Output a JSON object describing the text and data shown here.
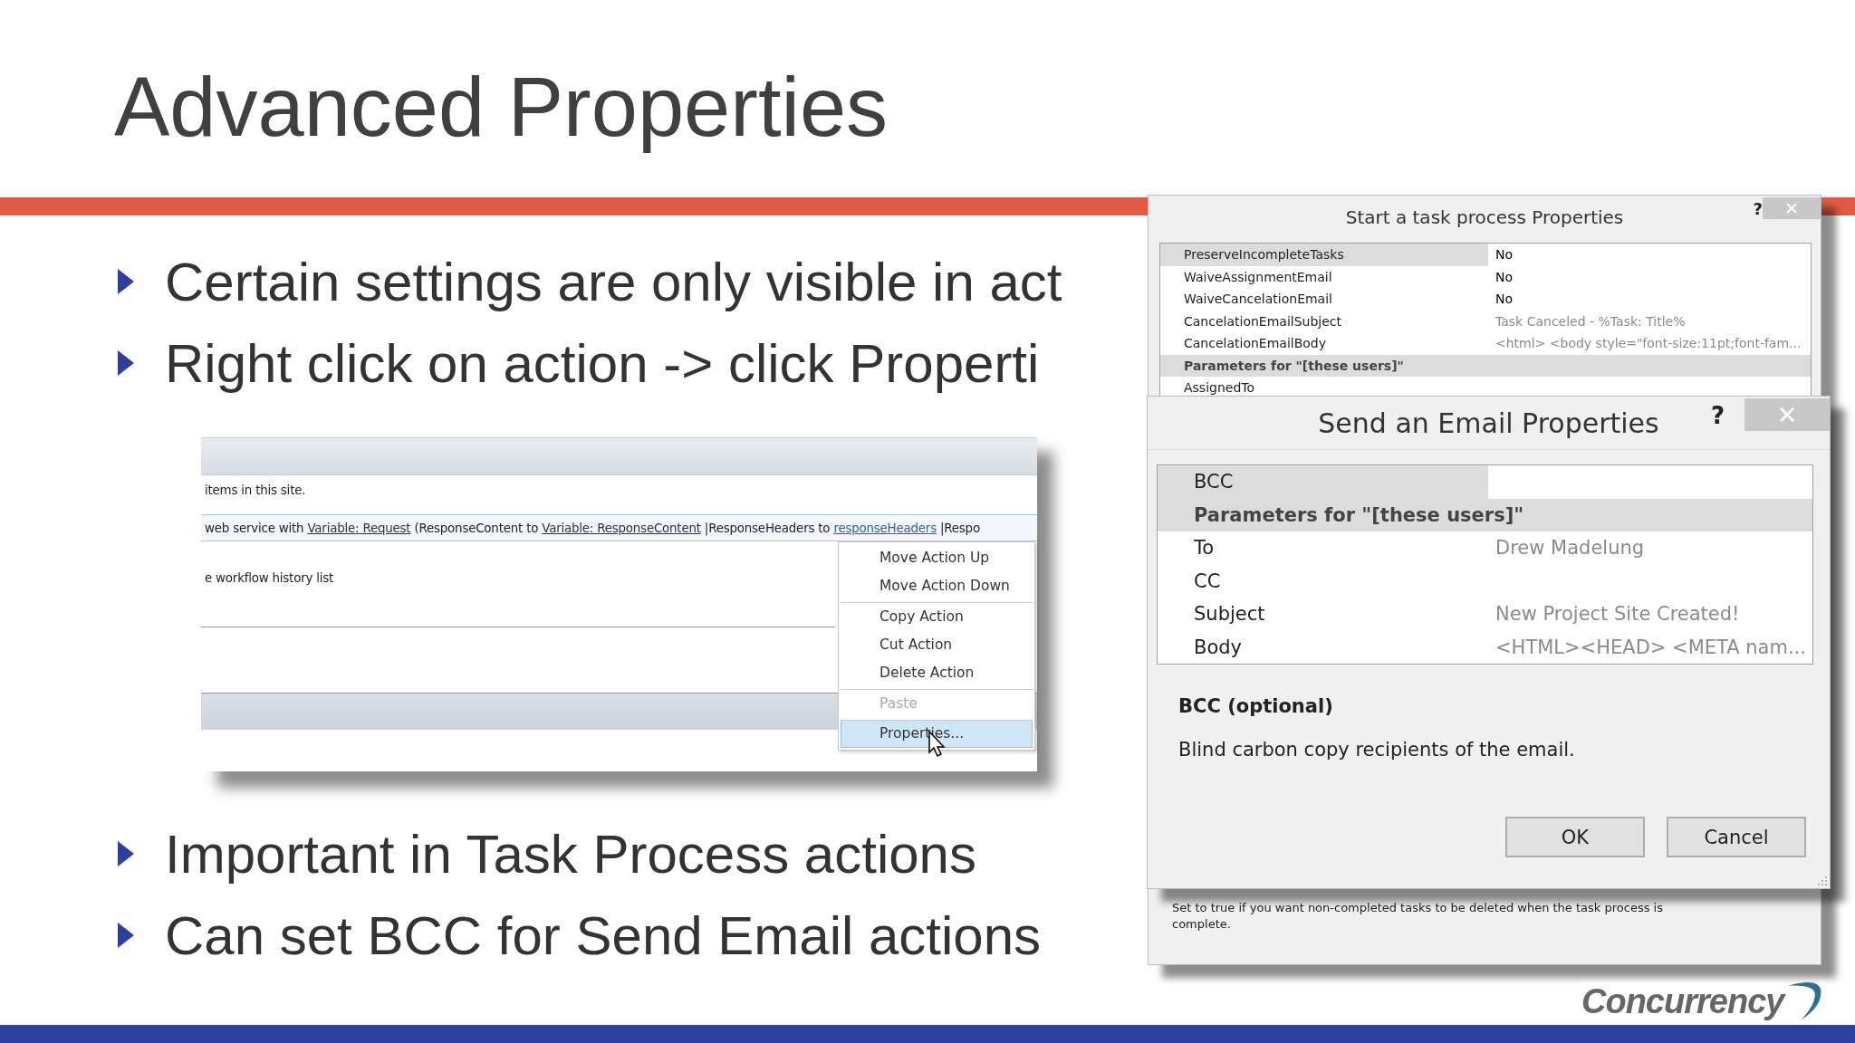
{
  "slide": {
    "title": "Advanced Properties",
    "bullets_top": [
      "Certain settings are only visible in act",
      "Right click on action -> click Properti"
    ],
    "bullets_bottom": [
      "Important in Task Process actions",
      "Can set BCC for Send Email actions"
    ]
  },
  "designer_screenshot": {
    "rows": [
      {
        "selected": false,
        "segments": [
          {
            "kind": "text",
            "text": "items in this site."
          }
        ]
      },
      {
        "selected": true,
        "segments": [
          {
            "kind": "text",
            "text": "web service with "
          },
          {
            "kind": "link",
            "text": "Variable: Request"
          },
          {
            "kind": "text",
            "text": " (ResponseContent to "
          },
          {
            "kind": "link",
            "text": "Variable: ResponseContent"
          },
          {
            "kind": "text",
            "text": " |ResponseHeaders to "
          },
          {
            "kind": "link_blue",
            "text": "responseHeaders"
          },
          {
            "kind": "text",
            "text": " |Respo"
          }
        ]
      },
      {
        "selected": false,
        "segments": [
          {
            "kind": "text",
            "text": "e workflow history list"
          }
        ]
      }
    ],
    "context_menu": [
      {
        "label": "Move Action Up",
        "disabled": false,
        "selected": false,
        "separator_before": false
      },
      {
        "label": "Move Action Down",
        "disabled": false,
        "selected": false,
        "separator_before": false
      },
      {
        "label": "Copy Action",
        "disabled": false,
        "selected": false,
        "separator_before": true
      },
      {
        "label": "Cut Action",
        "disabled": false,
        "selected": false,
        "separator_before": false
      },
      {
        "label": "Delete Action",
        "disabled": false,
        "selected": false,
        "separator_before": false
      },
      {
        "label": "Paste",
        "disabled": true,
        "selected": false,
        "separator_before": true
      },
      {
        "label": "Properties...",
        "disabled": false,
        "selected": true,
        "separator_before": true
      }
    ]
  },
  "task_dialog": {
    "title": "Start a task process Properties",
    "help": "?",
    "properties": [
      {
        "kind": "property",
        "name": "PreserveIncompleteTasks",
        "value": "No",
        "greyed": false,
        "selected": true
      },
      {
        "kind": "property",
        "name": "WaiveAssignmentEmail",
        "value": "No",
        "greyed": false,
        "selected": false
      },
      {
        "kind": "property",
        "name": "WaiveCancelationEmail",
        "value": "No",
        "greyed": false,
        "selected": false
      },
      {
        "kind": "property",
        "name": "CancelationEmailSubject",
        "value": "Task Canceled - %Task: Title%",
        "greyed": true,
        "selected": false
      },
      {
        "kind": "property",
        "name": "CancelationEmailBody",
        "value": "<html> <body style=\"font-size:11pt;font-fam...",
        "greyed": true,
        "selected": false
      },
      {
        "kind": "category",
        "name": "Parameters for \"[these users]\""
      },
      {
        "kind": "property",
        "name": "AssignedTo",
        "selected": false
      }
    ],
    "description": "Set to true if you want non-completed tasks to be deleted when the task process is complete."
  },
  "email_dialog": {
    "title": "Send an Email Properties",
    "help": "?",
    "properties": [
      {
        "kind": "property",
        "name": "BCC",
        "selected": true
      },
      {
        "kind": "category",
        "name": "Parameters for \"[these users]\""
      },
      {
        "kind": "property",
        "name": "To",
        "value": "Drew Madelung",
        "greyed": true,
        "selected": false
      },
      {
        "kind": "property",
        "name": "CC",
        "selected": false
      },
      {
        "kind": "property",
        "name": "Subject",
        "value": "New Project Site Created!",
        "greyed": true,
        "selected": false
      },
      {
        "kind": "property",
        "name": "Body",
        "value": "<HTML><HEAD> <META nam...",
        "greyed": true,
        "selected": false
      }
    ],
    "description_title": "BCC (optional)",
    "description": "Blind carbon copy recipients of the email.",
    "buttons": [
      "OK",
      "Cancel"
    ]
  },
  "logo": {
    "text": "Concurrency"
  }
}
